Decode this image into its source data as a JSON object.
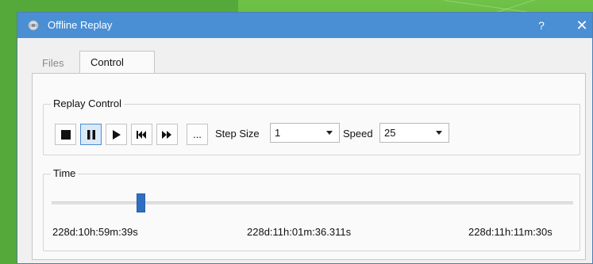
{
  "window": {
    "title": "Offline Replay",
    "help_label": "?",
    "close_label": "✕",
    "titlebar_color": "#4a8ed3"
  },
  "tabs": [
    {
      "label": "Files",
      "active": false
    },
    {
      "label": "Control",
      "active": true
    }
  ],
  "replay_control": {
    "title": "Replay Control",
    "buttons": [
      {
        "icon": "stop-icon"
      },
      {
        "icon": "pause-icon",
        "active": true
      },
      {
        "icon": "play-icon"
      },
      {
        "icon": "skip-to-start-icon"
      },
      {
        "icon": "fast-forward-icon"
      },
      {
        "icon": "more-icon",
        "label": "..."
      }
    ],
    "step_size": {
      "label": "Step Size",
      "value": "1"
    },
    "speed": {
      "label": "Speed",
      "value": "25"
    }
  },
  "time": {
    "title": "Time",
    "start": "228d:10h:59m:39s",
    "current": "228d:11h:01m:36.311s",
    "end": "228d:11h:11m:30s",
    "position": 0.17
  },
  "colors": {
    "accent": "#2f6fc2",
    "background": "#55a83a"
  }
}
